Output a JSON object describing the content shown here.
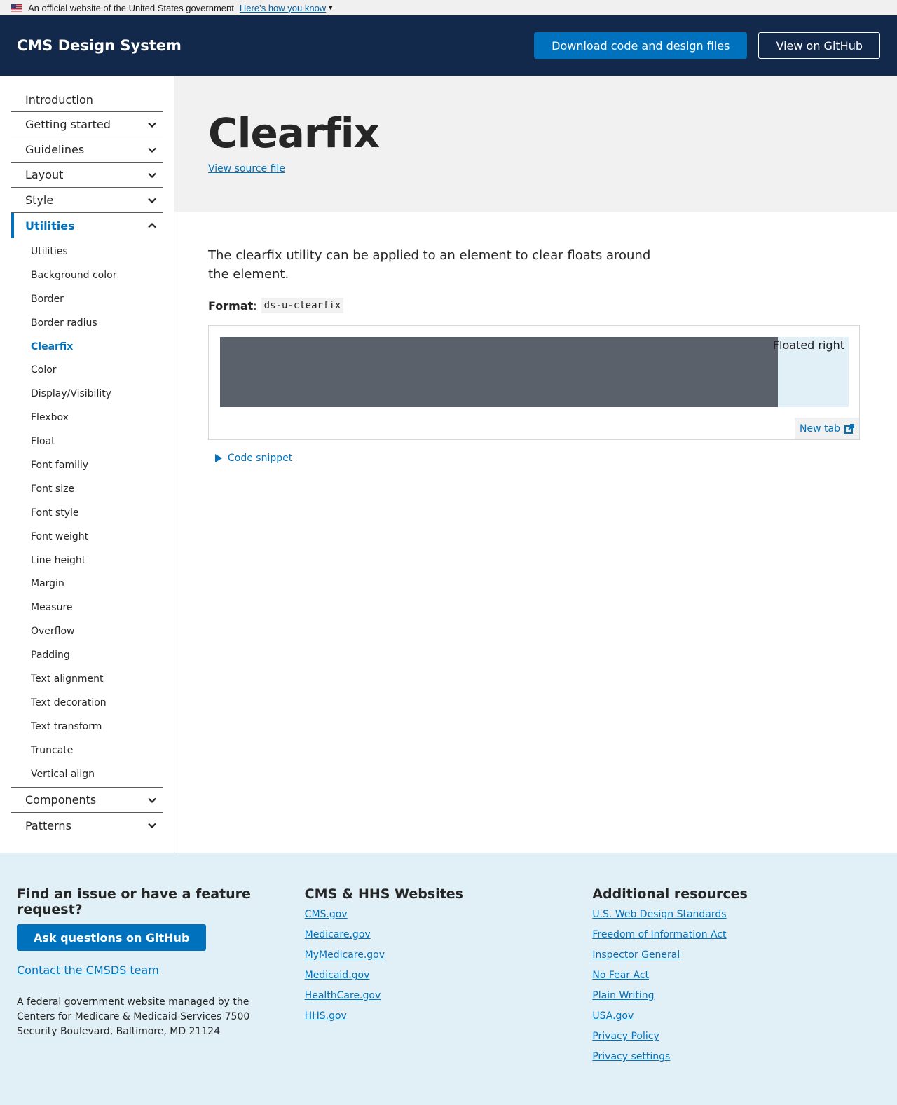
{
  "gov_banner": {
    "text": "An official website of the United States government",
    "link": "Here’s how you know"
  },
  "header": {
    "title": "CMS Design System",
    "download_label": "Download code and design files",
    "github_label": "View on GitHub"
  },
  "sidebar": {
    "items": [
      {
        "label": "Introduction"
      },
      {
        "label": "Getting started"
      },
      {
        "label": "Guidelines"
      },
      {
        "label": "Layout"
      },
      {
        "label": "Style"
      },
      {
        "label": "Utilities"
      }
    ],
    "utilities": [
      "Utilities",
      "Background color",
      "Border",
      "Border radius",
      "Clearfix",
      "Color",
      "Display/Visibility",
      "Flexbox",
      "Float",
      "Font familiy",
      "Font size",
      "Font style",
      "Font weight",
      "Line height",
      "Margin",
      "Measure",
      "Overflow",
      "Padding",
      "Text alignment",
      "Text decoration",
      "Text transform",
      "Truncate",
      "Vertical align"
    ],
    "after": [
      {
        "label": "Components"
      },
      {
        "label": "Patterns"
      }
    ],
    "current": "Clearfix"
  },
  "page": {
    "title": "Clearfix",
    "source_link": "View source file",
    "lead": "The clearfix utility can be applied to an element to clear floats around the element.",
    "format_label": "Format",
    "format_sep": ":",
    "format_code": "ds-u-clearfix",
    "example": {
      "float_label": "Floated right",
      "new_tab": "New tab"
    },
    "snippet_label": "Code snippet"
  },
  "footer": {
    "col1": {
      "heading": "Find an issue or have a feature request?",
      "button": "Ask questions on GitHub",
      "contact": "Contact the CMSDS team",
      "address": "A federal government website managed by the Centers for Medicare & Medicaid Services 7500 Security Boulevard, Baltimore, MD 21124"
    },
    "col2": {
      "heading": "CMS & HHS Websites",
      "links": [
        "CMS.gov",
        "Medicare.gov",
        "MyMedicare.gov",
        "Medicaid.gov",
        "HealthCare.gov",
        "HHS.gov"
      ]
    },
    "col3": {
      "heading": "Additional resources",
      "links": [
        "U.S. Web Design Standards",
        "Freedom of Information Act",
        "Inspector General",
        "No Fear Act",
        "Plain Writing",
        "USA.gov",
        "Privacy Policy",
        "Privacy settings"
      ]
    }
  },
  "colors": {
    "header_bg": "#13294b",
    "primary": "#0071bc",
    "footer_bg": "#e1f0f7"
  }
}
